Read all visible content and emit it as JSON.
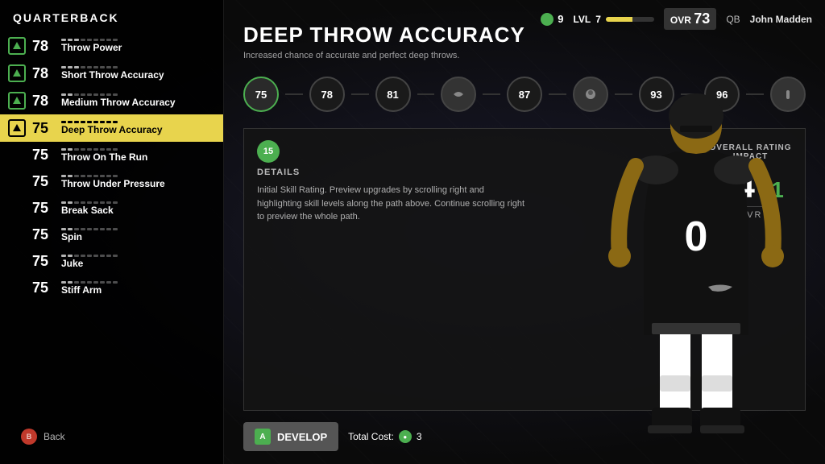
{
  "page": {
    "position": "QUARTERBACK",
    "back_label": "Back"
  },
  "header": {
    "coins": "9",
    "level_label": "LVL",
    "level_value": "7",
    "ovr_label": "OVR",
    "ovr_value": "73",
    "position_label": "QB",
    "player_name": "John Madden"
  },
  "selected_skill": {
    "title": "DEEP THROW ACCURACY",
    "description": "Increased chance of accurate and perfect deep throws.",
    "details_label": "DETAILS",
    "rating_impact_label": "OVERALL RATING IMPACT",
    "details_text": "Initial Skill Rating. Preview upgrades by scrolling right and highlighting skill levels along the path above. Continue scrolling right to preview the whole path.",
    "current_ovr": "74",
    "ovr_change": "+1",
    "ovr_label": "OVR",
    "develop_label": "Develop",
    "total_cost_label": "Total Cost:",
    "total_cost_value": "3",
    "current_level": "15",
    "upgrade_path": [
      {
        "value": "75",
        "type": "number",
        "active": false
      },
      {
        "value": "78",
        "type": "number",
        "active": false
      },
      {
        "value": "81",
        "type": "number",
        "active": false
      },
      {
        "value": "throw",
        "type": "icon",
        "active": false
      },
      {
        "value": "87",
        "type": "number",
        "active": false
      },
      {
        "value": "duck",
        "type": "icon",
        "active": false
      },
      {
        "value": "93",
        "type": "number",
        "active": false
      },
      {
        "value": "96",
        "type": "number",
        "active": false
      },
      {
        "value": "hand",
        "type": "icon",
        "active": false
      }
    ]
  },
  "skills": [
    {
      "rating": "78",
      "name": "Throw Power",
      "dots": 3,
      "has_icon": true
    },
    {
      "rating": "78",
      "name": "Short Throw Accuracy",
      "dots": 3,
      "has_icon": true
    },
    {
      "rating": "78",
      "name": "Medium Throw Accuracy",
      "dots": 2,
      "has_icon": true
    },
    {
      "rating": "75",
      "name": "Deep Throw Accuracy",
      "dots": 9,
      "has_icon": true,
      "active": true
    },
    {
      "rating": "75",
      "name": "Throw On The Run",
      "dots": 2,
      "has_icon": false
    },
    {
      "rating": "75",
      "name": "Throw Under Pressure",
      "dots": 2,
      "has_icon": false
    },
    {
      "rating": "75",
      "name": "Break Sack",
      "dots": 2,
      "has_icon": false
    },
    {
      "rating": "75",
      "name": "Spin",
      "dots": 2,
      "has_icon": false
    },
    {
      "rating": "75",
      "name": "Juke",
      "dots": 2,
      "has_icon": false
    },
    {
      "rating": "75",
      "name": "Stiff Arm",
      "dots": 2,
      "has_icon": false
    }
  ]
}
